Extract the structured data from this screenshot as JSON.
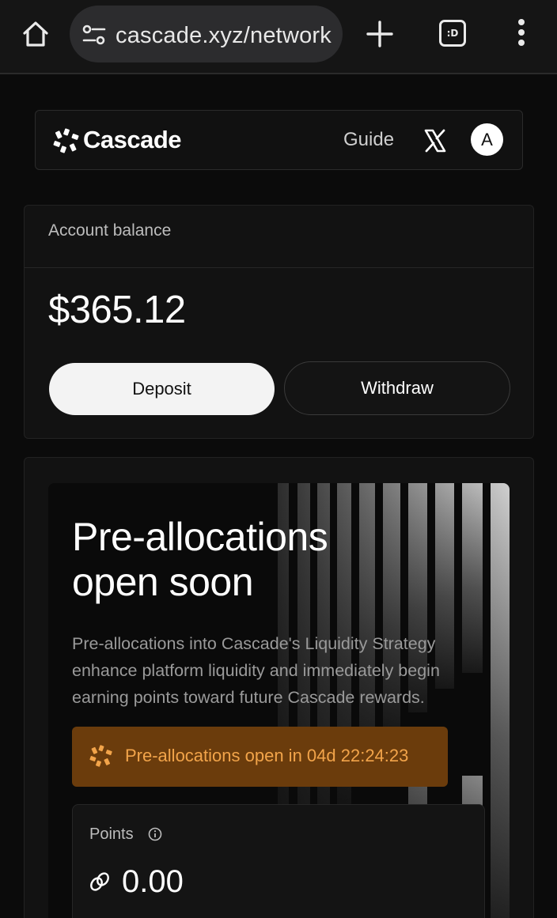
{
  "browser": {
    "url": "cascade.xyz/network",
    "tabs_label": ":D",
    "icons": [
      "home-icon",
      "site-settings-icon",
      "plus-icon",
      "tabs-icon",
      "more-vertical-icon"
    ]
  },
  "header": {
    "logo_text": "Cascade",
    "nav_guide": "Guide",
    "avatar_letter": "A",
    "icons": [
      "cascade-logo-icon",
      "x-icon"
    ]
  },
  "balance": {
    "label": "Account balance",
    "amount": "$365.12",
    "deposit_label": "Deposit",
    "withdraw_label": "Withdraw"
  },
  "preallocation": {
    "title_line1": "Pre-allocations",
    "title_line2": "open soon",
    "description": "Pre-allocations into Cascade's Liquidity Strategy enhance platform liquidity and immediately begin earning points toward future Cascade rewards.",
    "countdown_text": "Pre-allocations open in 04d 22:24:23",
    "points_label": "Points",
    "points_value": "0.00",
    "icons": [
      "cascade-logo-icon",
      "info-icon",
      "link-icon"
    ]
  },
  "colors": {
    "background": "#0b0b0b",
    "card": "#121212",
    "accent_orange": "#f2a44a",
    "countdown_bg": "#6b3c0c"
  }
}
